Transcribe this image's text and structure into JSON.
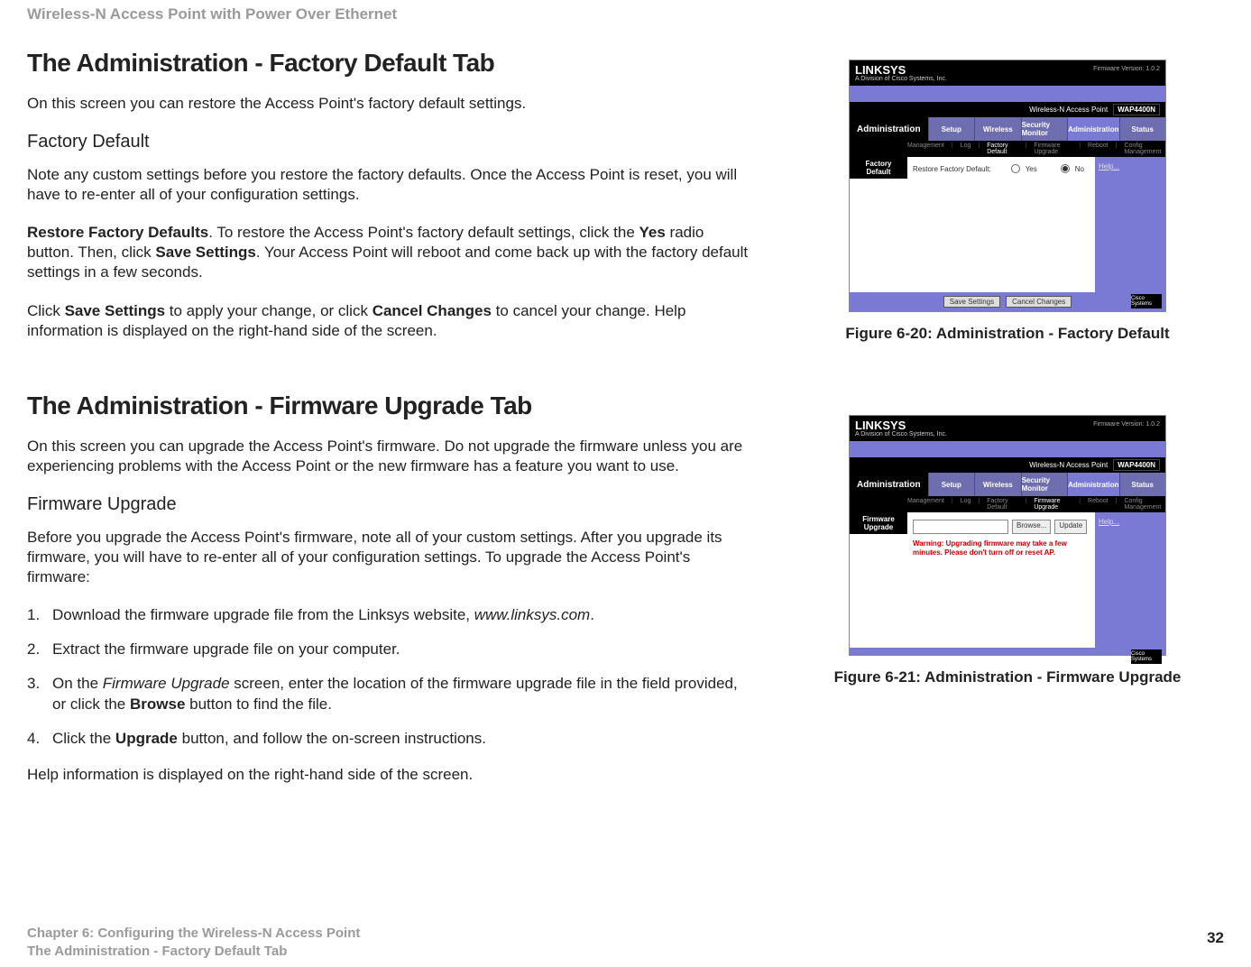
{
  "running_head": "Wireless-N Access Point with Power Over Ethernet",
  "page_number": "32",
  "footer_chapter": "Chapter 6: Configuring the Wireless-N Access Point",
  "footer_section": "The Administration - Factory Default Tab",
  "s1": {
    "h": "The Administration - Factory Default Tab",
    "p1": "On this screen you can restore the Access Point's factory default settings.",
    "sub": "Factory Default",
    "p2": "Note any custom settings before you restore the factory defaults. Once the Access Point is reset, you will have to re-enter all of your configuration settings.",
    "p3a": "Restore Factory Defaults",
    "p3b": ". To restore the Access Point's factory default settings, click the ",
    "p3c": "Yes",
    "p3d": " radio button. Then, click ",
    "p3e": "Save Settings",
    "p3f": ". Your Access Point will reboot and come back up with the factory default settings in a few seconds.",
    "p4a": "Click ",
    "p4b": "Save Settings",
    "p4c": " to apply your change, or click ",
    "p4d": "Cancel Changes",
    "p4e": " to cancel your change. Help information is displayed on the right-hand side of the screen."
  },
  "s2": {
    "h": "The Administration - Firmware Upgrade Tab",
    "p1": "On this screen you can upgrade the Access Point's firmware. Do not upgrade the firmware unless you are experiencing problems with the Access Point or the new firmware has a feature you want to use.",
    "sub": "Firmware Upgrade",
    "p2": "Before you upgrade the Access Point's firmware, note all of your custom settings. After you upgrade its firmware, you will have to re-enter all of your configuration settings. To upgrade the Access Point's firmware:",
    "steps": {
      "a1": "Download the firmware upgrade file from the Linksys website, ",
      "a1i": "www.linksys.com",
      "a1e": ".",
      "a2": "Extract the firmware upgrade file on your computer.",
      "a3a": "On the ",
      "a3i": "Firmware Upgrade",
      "a3b": " screen, enter the location of the firmware upgrade file in the field provided, or click the ",
      "a3bold": "Browse",
      "a3c": " button to find the file.",
      "a4a": "Click the ",
      "a4bold": "Upgrade",
      "a4b": " button, and follow the on-screen instructions."
    },
    "p3": "Help information is displayed on the right-hand side of the screen."
  },
  "fig20": {
    "caption": "Figure 6-20: Administration - Factory Default",
    "logo": "LINKSYS",
    "logo_sub": "A Division of Cisco Systems, Inc.",
    "ver": "Firmware Version: 1.0.2",
    "product": "Wireless-N Access Point",
    "model": "WAP4400N",
    "section": "Administration",
    "tabs": [
      "Setup",
      "Wireless",
      "Security Monitor",
      "Administration",
      "Status"
    ],
    "subtabs": [
      "Management",
      "Log",
      "Factory Default",
      "Firmware Upgrade",
      "Reboot",
      "Config Management"
    ],
    "chip": "Factory Default",
    "label": "Restore Factory Default:",
    "opt_yes": "Yes",
    "opt_no": "No",
    "help": "Help...",
    "save": "Save Settings",
    "cancel": "Cancel Changes",
    "cisco": "Cisco Systems"
  },
  "fig21": {
    "caption": "Figure 6-21: Administration - Firmware Upgrade",
    "logo": "LINKSYS",
    "logo_sub": "A Division of Cisco Systems, Inc.",
    "ver": "Firmware Version: 1.0.2",
    "product": "Wireless-N Access Point",
    "model": "WAP4400N",
    "section": "Administration",
    "tabs": [
      "Setup",
      "Wireless",
      "Security Monitor",
      "Administration",
      "Status"
    ],
    "subtabs": [
      "Management",
      "Log",
      "Factory Default",
      "Firmware Upgrade",
      "Reboot",
      "Config Management"
    ],
    "chip": "Firmware Upgrade",
    "browse": "Browse...",
    "update": "Update",
    "warn": "Warning: Upgrading firmware may take a few minutes. Please don't turn off or reset AP.",
    "help": "Help...",
    "cisco": "Cisco Systems"
  }
}
